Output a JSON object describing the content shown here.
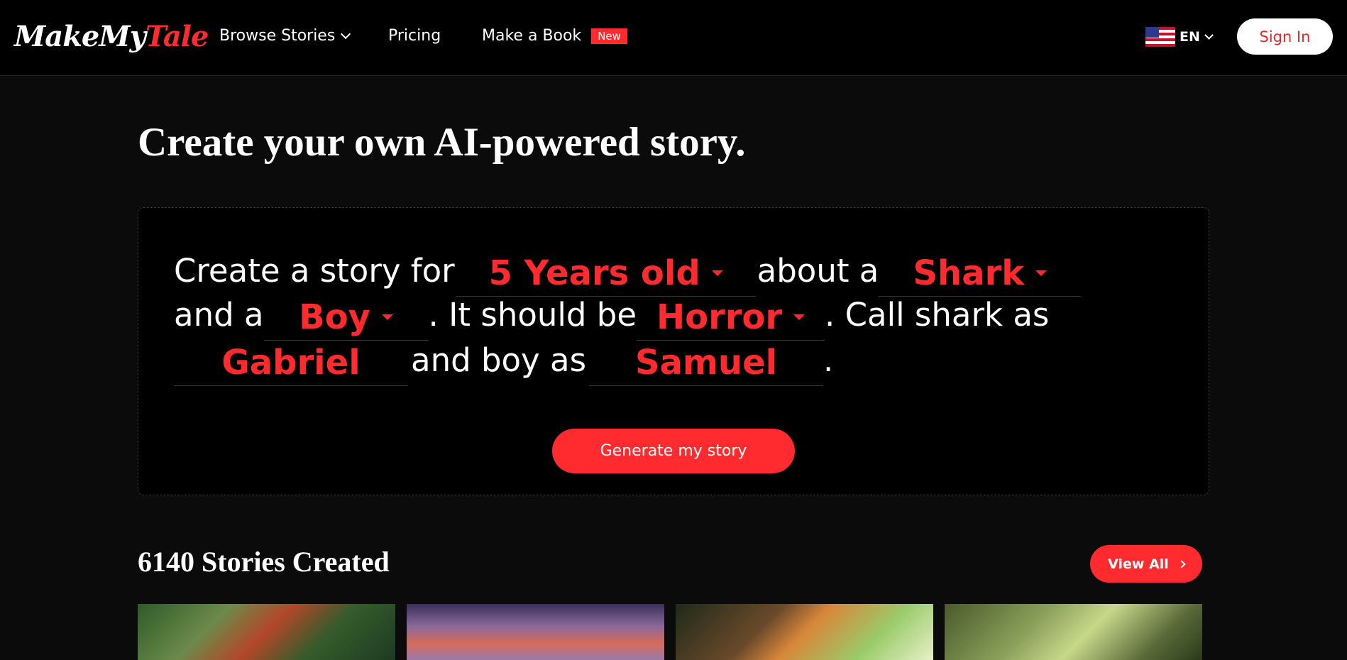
{
  "header": {
    "logo_part1": "MakeMy",
    "logo_part2": "Tale",
    "nav": {
      "browse": "Browse Stories",
      "pricing": "Pricing",
      "make_book": "Make a Book",
      "new_badge": "New"
    },
    "language": "EN",
    "sign_in": "Sign In"
  },
  "page_title": "Create your own AI-powered story.",
  "builder": {
    "text_create_for": "Create a story for",
    "age": "5 Years old",
    "text_about": "about a",
    "character1": "Shark",
    "text_and_a": "and a",
    "character2": "Boy",
    "text_should_be": ". It should be",
    "genre": "Horror",
    "text_call_shark": ". Call shark as",
    "name1": "Gabriel",
    "text_and_boy": "and boy as",
    "name2": "Samuel",
    "text_period": ".",
    "generate_label": "Generate my story"
  },
  "stories": {
    "count_title": "6140 Stories Created",
    "view_all": "View All"
  },
  "colors": {
    "accent": "#ff2b2e",
    "background": "#0b0b0b",
    "header_bg": "#000000"
  }
}
